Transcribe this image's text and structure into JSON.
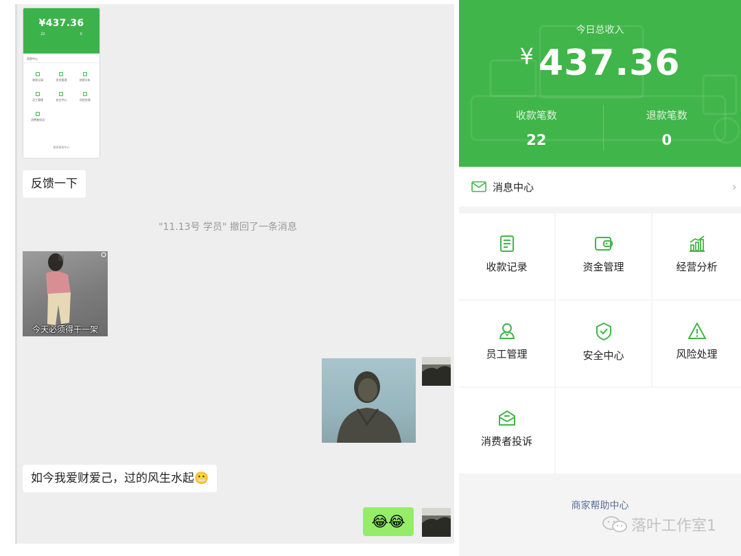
{
  "chat": {
    "screenshot_thumb": {
      "amount": "¥437.36",
      "stat1": "22",
      "stat2": "0",
      "message_center": "消息中心",
      "items": [
        "收款记录",
        "资金管理",
        "经营分析",
        "员工管理",
        "安全中心",
        "风险处理",
        "消费者投诉"
      ],
      "footer": "商家帮助中心"
    },
    "msg_feedback": "反馈一下",
    "recall_notice": "\"11.13号 学员\" 撤回了一条消息",
    "sticker_caption": "今天必须得干一架",
    "msg_main": "如今我爱财爱己，过的风生水起",
    "msg_emoji_inline": "😬",
    "emoji_reply": "😂😂"
  },
  "panel": {
    "today_label": "今日总收入",
    "currency": "¥",
    "amount": "437.36",
    "stats": [
      {
        "label": "收款笔数",
        "value": "22"
      },
      {
        "label": "退款笔数",
        "value": "0"
      }
    ],
    "message_center": "消息中心",
    "tiles": [
      {
        "label": "收款记录",
        "icon": "receipt-icon"
      },
      {
        "label": "资金管理",
        "icon": "wallet-icon"
      },
      {
        "label": "经营分析",
        "icon": "bar-chart-icon"
      },
      {
        "label": "员工管理",
        "icon": "person-icon"
      },
      {
        "label": "安全中心",
        "icon": "shield-icon"
      },
      {
        "label": "风险处理",
        "icon": "warning-icon"
      },
      {
        "label": "消费者投诉",
        "icon": "complaint-envelope-icon"
      }
    ],
    "help_link": "商家帮助中心"
  },
  "watermark": "落叶工作室1",
  "colors": {
    "brand_green": "#40b549",
    "bubble_green": "#95ec69",
    "link_blue": "#5a6f98"
  }
}
